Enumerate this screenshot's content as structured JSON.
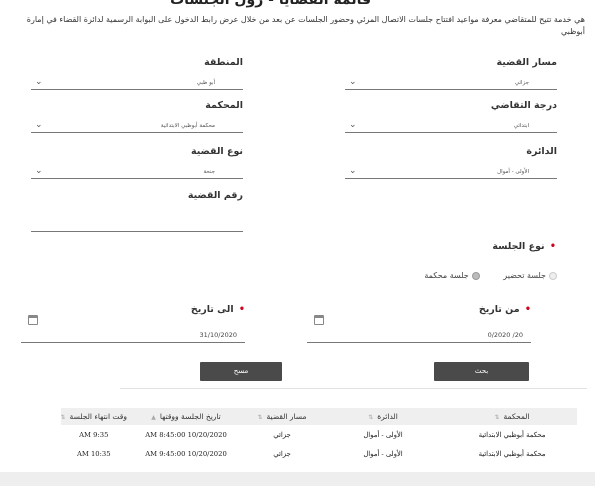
{
  "page": {
    "title": "قائمة القضايا - رول الجلسات",
    "intro": "هي خدمة تتيح للمتقاضي معرفة مواعيد افتتاح جلسات الاتصال المرئي وحضور الجلسات عن بعد من خلال عرض رابط الدخول على البوابة الرسمية لدائرة القضاء في إمارة أبوظبي"
  },
  "form": {
    "case_path": {
      "label": "مسار القضية",
      "value": "جزائي"
    },
    "region": {
      "label": "المنطقة",
      "value": "أبو ظبي"
    },
    "litigation_level": {
      "label": "درجة التقاضي",
      "value": "ابتدائي"
    },
    "court": {
      "label": "المحكمة",
      "value": "محكمة أبوظبي الابتدائية"
    },
    "circuit": {
      "label": "الدائرة",
      "value": "الأولى - أموال"
    },
    "case_type": {
      "label": "نوع القضية",
      "value": "جنحة"
    },
    "case_number": {
      "label": "رقم القضية",
      "value": ""
    },
    "session_type": {
      "label": "نوع الجلسة",
      "options": [
        "جلسة تحضير",
        "جلسة محكمة"
      ],
      "selected": "جلسة محكمة"
    },
    "from_date": {
      "label": "من تاريخ",
      "value": "20/ 0/2020"
    },
    "to_date": {
      "label": "الى تاريخ",
      "value": "31/10/2020"
    },
    "search_label": "بحث",
    "clear_label": "مسح"
  },
  "table": {
    "headers": [
      "المحكمة",
      "الدائرة",
      "مسار القضية",
      "تاريخ الجلسة ووقتها",
      "وقت انتهاء الجلسة"
    ],
    "rows": [
      [
        "محكمة أبوظبي الابتدائية",
        "الأولى - أموال",
        "جزائي",
        "AM 8:45:00 10/20/2020",
        "AM 9:35"
      ],
      [
        "محكمة أبوظبي الابتدائية",
        "الأولى - أموال",
        "جزائي",
        "AM 9:45:00 10/20/2020",
        "AM 10:35"
      ]
    ]
  },
  "colors": {
    "button": "#4a4a4a",
    "required": "#d0021b",
    "header_bg": "#efefef"
  }
}
